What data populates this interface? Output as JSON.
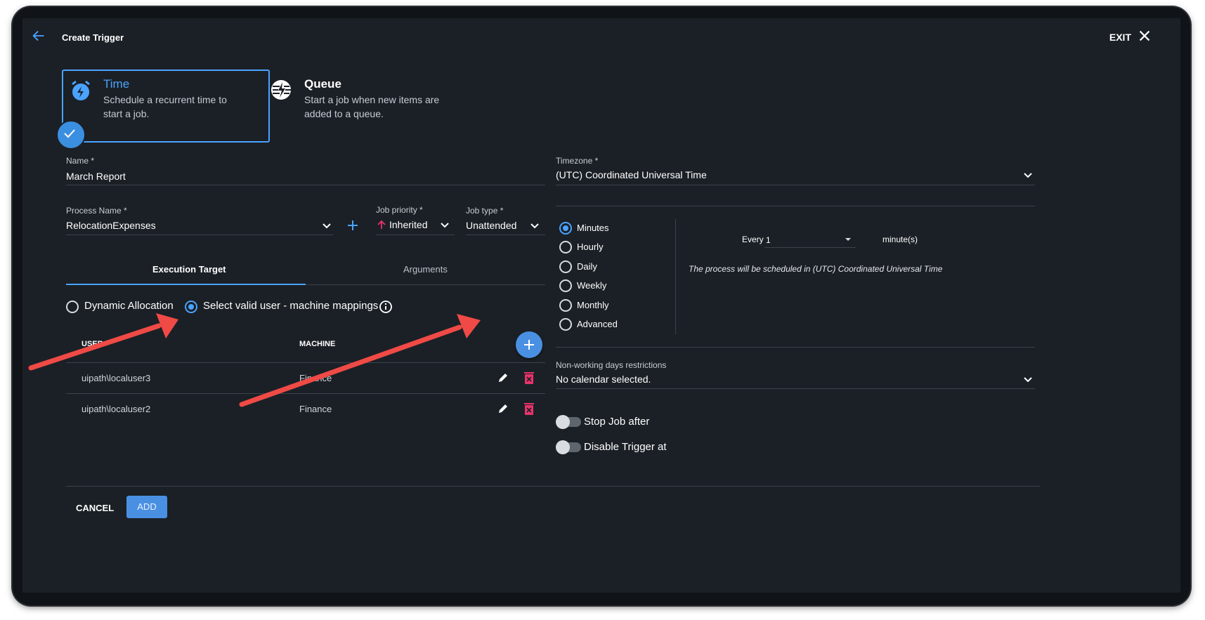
{
  "header": {
    "title": "Create Trigger",
    "exit_label": "EXIT"
  },
  "trigger_types": [
    {
      "title": "Time",
      "description": "Schedule a recurrent time to start a job."
    },
    {
      "title": "Queue",
      "description": "Start a job when new items are added to a queue."
    }
  ],
  "form": {
    "name_label": "Name *",
    "name_value": "March Report",
    "process_label": "Process Name *",
    "process_value": "RelocationExpenses",
    "priority_label": "Job priority *",
    "priority_value": "Inherited",
    "jobtype_label": "Job type *",
    "jobtype_value": "Unattended",
    "timezone_label": "Timezone *",
    "timezone_value": "(UTC) Coordinated Universal Time"
  },
  "tabs": [
    "Execution Target",
    "Arguments"
  ],
  "execution": {
    "option_dynamic": "Dynamic Allocation",
    "option_mappings": "Select valid user - machine mappings",
    "col_user": "USER",
    "col_machine": "MACHINE",
    "rows": [
      {
        "user": "uipath\\localuser3",
        "machine": "Finance"
      },
      {
        "user": "uipath\\localuser2",
        "machine": "Finance"
      }
    ]
  },
  "schedule": {
    "frequencies": [
      "Minutes",
      "Hourly",
      "Daily",
      "Weekly",
      "Monthly",
      "Advanced"
    ],
    "selected": "Minutes",
    "every_label": "Every",
    "every_value": "1",
    "unit": "minute(s)",
    "note": "The process will be scheduled in (UTC) Coordinated Universal Time"
  },
  "calendar": {
    "label": "Non-working days restrictions",
    "value": "No calendar selected."
  },
  "toggles": {
    "stop_job": "Stop Job after",
    "disable_trigger": "Disable Trigger at"
  },
  "footer": {
    "cancel": "CANCEL",
    "add": "ADD"
  },
  "colors": {
    "accent": "#4aa3ff",
    "primary_button": "#4a90e2",
    "delete": "#e8336b",
    "annotation_arrow": "#f04a46"
  }
}
